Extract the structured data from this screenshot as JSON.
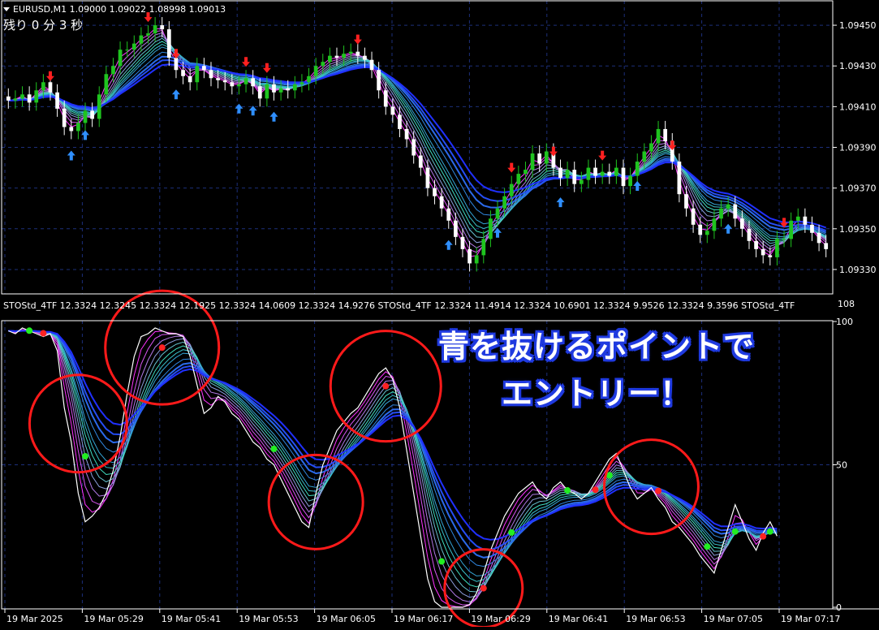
{
  "price_panel": {
    "header": "EURUSD,M1  1.09000 1.09022 1.08998 1.09013",
    "timer": "残り 0 分 3 秒"
  },
  "osc_panel": {
    "header": "STOStd_4TF 12.3324 12.3245 12.3324 12.1925 12.3324 14.0609 12.3324 14.9276  STOStd_4TF 12.3324 11.4914 12.3324 10.6901 12.3324 9.9526 12.3324 9.3596  STOStd_4TF",
    "scale_top": "108"
  },
  "annotation": {
    "line1": "青を抜けるポイントで",
    "line2": "エントリー！"
  },
  "colors": {
    "background": "#000000",
    "grid": "#1c2f7a",
    "bull_candle": "#1fc41f",
    "bear_candle": "#ffffff",
    "arrow_up": "#2f8fff",
    "arrow_down": "#ff2020",
    "circle": "#ff1a1a",
    "dot_green": "#22ee22",
    "dot_red": "#ff2222"
  },
  "chart_data": [
    {
      "type": "candlestick",
      "symbol": "EURUSD,M1",
      "ylim": [
        1.09322,
        1.0946
      ],
      "y_ticks": [
        1.0945,
        1.0943,
        1.0941,
        1.0939,
        1.0937,
        1.0935,
        1.0933
      ],
      "close": [
        1.09413,
        1.09414,
        1.09416,
        1.09412,
        1.09418,
        1.09422,
        1.09417,
        1.09409,
        1.094,
        1.09398,
        1.09402,
        1.09408,
        1.09404,
        1.09416,
        1.09426,
        1.0943,
        1.09438,
        1.09438,
        1.09441,
        1.09445,
        1.09446,
        1.0945,
        1.09448,
        1.09434,
        1.09428,
        1.09425,
        1.09422,
        1.0943,
        1.09428,
        1.09424,
        1.09423,
        1.09422,
        1.0942,
        1.09421,
        1.09424,
        1.0942,
        1.09414,
        1.09421,
        1.09417,
        1.09419,
        1.09418,
        1.09421,
        1.09422,
        1.09425,
        1.0943,
        1.09432,
        1.09435,
        1.09434,
        1.09436,
        1.09437,
        1.09435,
        1.09433,
        1.09428,
        1.09418,
        1.0941,
        1.09406,
        1.09399,
        1.09394,
        1.09386,
        1.0938,
        1.0937,
        1.09366,
        1.0936,
        1.09354,
        1.09346,
        1.0934,
        1.09333,
        1.09337,
        1.09345,
        1.09355,
        1.0936,
        1.09366,
        1.09372,
        1.09377,
        1.09379,
        1.09387,
        1.09382,
        1.09388,
        1.0938,
        1.09375,
        1.09379,
        1.09372,
        1.09374,
        1.0938,
        1.09376,
        1.09378,
        1.09376,
        1.0938,
        1.09371,
        1.09376,
        1.09383,
        1.09388,
        1.09392,
        1.09399,
        1.09393,
        1.09383,
        1.09367,
        1.0936,
        1.09352,
        1.09347,
        1.09349,
        1.09355,
        1.0936,
        1.09362,
        1.09355,
        1.0935,
        1.09344,
        1.0934,
        1.09337,
        1.09336,
        1.09345,
        1.09345,
        1.09354,
        1.09356,
        1.09352,
        1.09348,
        1.09343,
        1.0934
      ],
      "up_arrows_at": [
        9,
        11,
        24,
        33,
        35,
        38,
        63,
        70,
        79,
        90,
        103
      ],
      "down_arrows_at": [
        6,
        20,
        24,
        34,
        37,
        50,
        72,
        78,
        85,
        95,
        111
      ],
      "x_ticks": [
        "19 Mar 2025",
        "19 Mar 05:29",
        "19 Mar 05:41",
        "19 Mar 05:53",
        "19 Mar 06:05",
        "19 Mar 06:17",
        "19 Mar 06:29",
        "19 Mar 06:41",
        "19 Mar 06:53",
        "19 Mar 07:05",
        "19 Mar 07:17"
      ]
    },
    {
      "type": "line",
      "name": "STOStd_4TF",
      "ylim": [
        0,
        100
      ],
      "y_ticks": [
        100,
        50,
        0
      ],
      "values": [
        97,
        96,
        98,
        97,
        96,
        95,
        96,
        90,
        70,
        58,
        40,
        30,
        32,
        35,
        40,
        48,
        60,
        75,
        88,
        95,
        96,
        98,
        97,
        96,
        96,
        95,
        88,
        78,
        68,
        70,
        74,
        72,
        68,
        66,
        62,
        58,
        56,
        52,
        50,
        45,
        40,
        35,
        30,
        28,
        40,
        50,
        56,
        62,
        65,
        68,
        70,
        74,
        78,
        82,
        84,
        80,
        70,
        55,
        40,
        25,
        10,
        2,
        0,
        0,
        0,
        0,
        1,
        5,
        12,
        20,
        26,
        32,
        36,
        40,
        42,
        44,
        40,
        38,
        42,
        44,
        41,
        40,
        38,
        40,
        44,
        48,
        52,
        54,
        48,
        42,
        38,
        40,
        42,
        38,
        35,
        30,
        28,
        25,
        22,
        18,
        15,
        12,
        20,
        28,
        36,
        30,
        24,
        20,
        26,
        30,
        25
      ]
    }
  ]
}
